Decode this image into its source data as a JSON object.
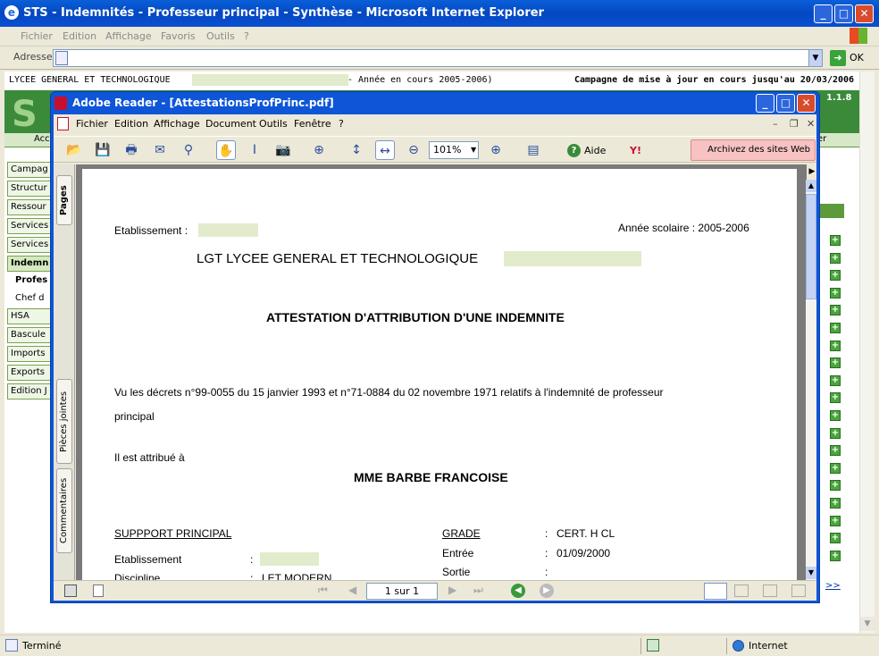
{
  "ie": {
    "title": "STS - Indemnités - Professeur principal - Synthèse - Microsoft Internet Explorer",
    "menu": [
      "Fichier",
      "Edition",
      "Affichage",
      "Favoris",
      "Outils",
      "?"
    ],
    "address_label": "Adresse",
    "go_label": "OK",
    "status_text": "Terminé",
    "zone_text": "Internet"
  },
  "site": {
    "header_left": "LYCEE GENERAL ET TECHNOLOGIQUE",
    "header_mid": "- Année en cours 2005-2006)",
    "header_right": "Campagne de mise à jour en cours jusqu'au 20/03/2006",
    "version": "1.1.8",
    "tab_left": "Acc",
    "tab_right": "er",
    "side_items": [
      "Campag",
      "Structur",
      "Ressour",
      "Services",
      "Services",
      "Indemn"
    ],
    "side_subs": [
      "Profes",
      "Chef d"
    ],
    "side_items2": [
      "HSA",
      "Bascule",
      "Imports",
      "Exports",
      "Edition J"
    ],
    "more_link": ">>"
  },
  "reader": {
    "title": "Adobe Reader - [AttestationsProfPrinc.pdf]",
    "menu": [
      "Fichier",
      "Edition",
      "Affichage",
      "Document",
      "Outils",
      "Fenêtre",
      "?"
    ],
    "zoom": "101%",
    "help_label": "Aide",
    "archive_label": "Archivez des sites Web",
    "tab_pages": "Pages",
    "tab_attachments": "Pièces jointes",
    "tab_comments": "Commentaires",
    "page_indicator": "1 sur 1"
  },
  "document": {
    "etab_label": "Etablissement :",
    "year": "Année scolaire : 2005-2006",
    "school": "LGT LYCEE GENERAL ET TECHNOLOGIQUE",
    "heading": "ATTESTATION D'ATTRIBUTION D'UNE INDEMNITE",
    "para_line1": "Vu les décrets n°99-0055 du 15 janvier 1993 et n°71-0884 du 02 novembre 1971 relatifs à l'indemnité de professeur",
    "para_line2": "principal",
    "attrib": "Il est attribué à",
    "name": "MME BARBE FRANCOISE",
    "support_heading": "SUPPPORT PRINCIPAL",
    "support_etab": "Etablissement",
    "support_discipline": "Discipline",
    "discipline_value": "LET MODERN",
    "grade_heading": "GRADE",
    "grade_value": "CERT. H CL",
    "entree_label": "Entrée",
    "entree_value": "01/09/2000",
    "sortie_label": "Sortie",
    "colon": ":"
  }
}
